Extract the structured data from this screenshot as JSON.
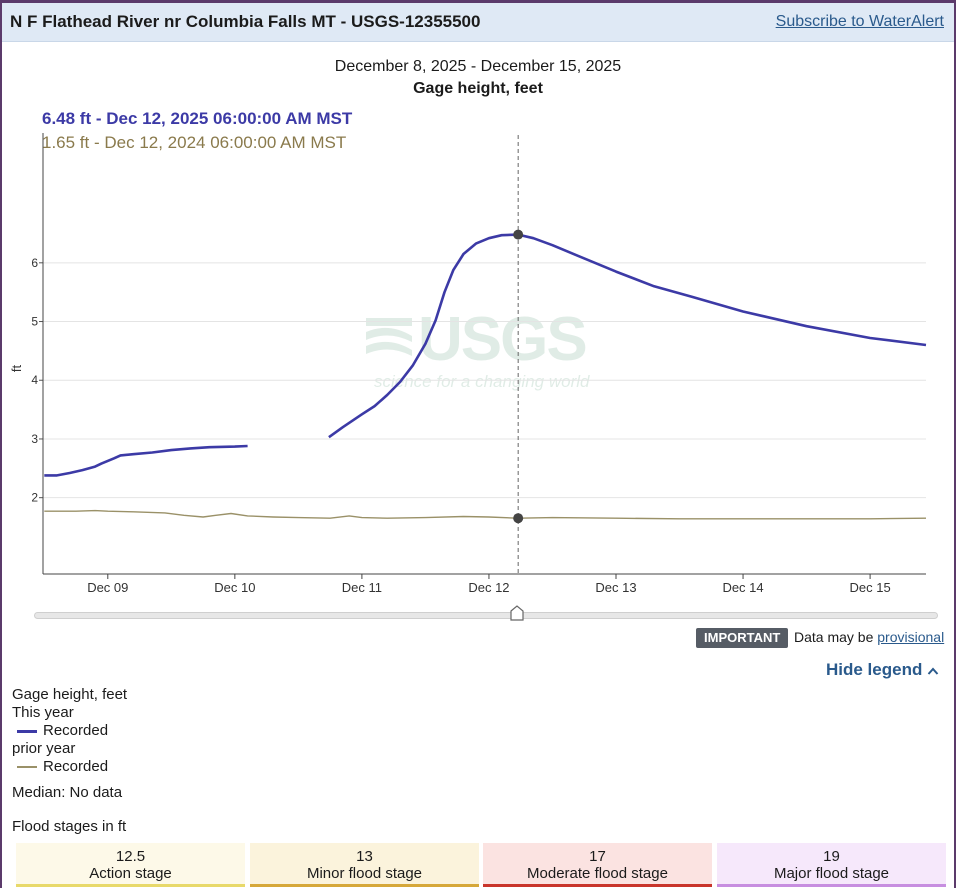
{
  "header": {
    "site_title": "N F Flathead River nr Columbia Falls MT - USGS-12355500",
    "subscribe_label": "Subscribe to WaterAlert"
  },
  "chart_header": {
    "date_range": "December 8, 2025 - December 15, 2025",
    "title": "Gage height, feet"
  },
  "tooltip": {
    "current": "6.48 ft - Dec 12, 2025 06:00:00 AM MST",
    "prior": "1.65 ft - Dec 12, 2024 06:00:00 AM MST"
  },
  "watermark": {
    "brand": "USGS",
    "tagline": "science for a changing world"
  },
  "colors": {
    "current": "#3c3aa6",
    "prior": "#9a9168",
    "accent": "#2a5a8c"
  },
  "chart_data": {
    "type": "line",
    "xlabel": "",
    "ylabel": "ft",
    "x_unit": "days since Dec 08 00:00",
    "xlim": [
      0.49,
      7.44
    ],
    "ylim": [
      0.7,
      7.7
    ],
    "y_ticks": [
      2,
      3,
      4,
      5,
      6
    ],
    "x_ticks": [
      {
        "pos": 1.0,
        "label": "Dec 09"
      },
      {
        "pos": 2.0,
        "label": "Dec 10"
      },
      {
        "pos": 3.0,
        "label": "Dec 11"
      },
      {
        "pos": 4.0,
        "label": "Dec 12"
      },
      {
        "pos": 5.0,
        "label": "Dec 13"
      },
      {
        "pos": 6.0,
        "label": "Dec 14"
      },
      {
        "pos": 7.0,
        "label": "Dec 15"
      }
    ],
    "cursor_x": 4.23,
    "series": [
      {
        "name": "This year",
        "segments": [
          [
            [
              0.5,
              2.38
            ],
            [
              0.6,
              2.38
            ],
            [
              0.7,
              2.42
            ],
            [
              0.8,
              2.47
            ],
            [
              0.9,
              2.53
            ],
            [
              0.95,
              2.58
            ],
            [
              1.05,
              2.67
            ],
            [
              1.1,
              2.72
            ],
            [
              1.2,
              2.74
            ],
            [
              1.35,
              2.77
            ],
            [
              1.5,
              2.81
            ],
            [
              1.65,
              2.84
            ],
            [
              1.8,
              2.86
            ],
            [
              2.0,
              2.87
            ],
            [
              2.1,
              2.88
            ]
          ],
          [
            [
              2.74,
              3.03
            ],
            [
              2.85,
              3.2
            ],
            [
              3.0,
              3.42
            ],
            [
              3.1,
              3.56
            ],
            [
              3.2,
              3.75
            ],
            [
              3.3,
              3.97
            ],
            [
              3.4,
              4.25
            ],
            [
              3.5,
              4.62
            ],
            [
              3.58,
              5.02
            ],
            [
              3.65,
              5.5
            ],
            [
              3.72,
              5.88
            ],
            [
              3.8,
              6.15
            ],
            [
              3.9,
              6.33
            ],
            [
              4.0,
              6.42
            ],
            [
              4.1,
              6.47
            ],
            [
              4.23,
              6.48
            ],
            [
              4.35,
              6.42
            ],
            [
              4.5,
              6.3
            ],
            [
              4.7,
              6.12
            ],
            [
              5.0,
              5.85
            ],
            [
              5.3,
              5.6
            ],
            [
              5.6,
              5.42
            ],
            [
              6.0,
              5.17
            ],
            [
              6.5,
              4.92
            ],
            [
              7.0,
              4.72
            ],
            [
              7.44,
              4.6
            ]
          ]
        ]
      },
      {
        "name": "prior year",
        "segments": [
          [
            [
              0.5,
              1.77
            ],
            [
              0.75,
              1.77
            ],
            [
              0.9,
              1.78
            ],
            [
              1.0,
              1.77
            ],
            [
              1.2,
              1.76
            ],
            [
              1.45,
              1.74
            ],
            [
              1.6,
              1.7
            ],
            [
              1.75,
              1.67
            ],
            [
              1.85,
              1.7
            ],
            [
              1.97,
              1.73
            ],
            [
              2.1,
              1.69
            ],
            [
              2.3,
              1.67
            ],
            [
              2.5,
              1.66
            ],
            [
              2.75,
              1.65
            ],
            [
              2.9,
              1.69
            ],
            [
              3.0,
              1.66
            ],
            [
              3.2,
              1.65
            ],
            [
              3.5,
              1.66
            ],
            [
              3.8,
              1.68
            ],
            [
              4.0,
              1.67
            ],
            [
              4.23,
              1.65
            ],
            [
              4.5,
              1.66
            ],
            [
              5.0,
              1.65
            ],
            [
              5.5,
              1.64
            ],
            [
              6.0,
              1.64
            ],
            [
              6.5,
              1.64
            ],
            [
              7.0,
              1.64
            ],
            [
              7.44,
              1.65
            ]
          ]
        ]
      }
    ]
  },
  "provisional": {
    "badge": "IMPORTANT",
    "text": "Data may be",
    "link": "provisional"
  },
  "legend": {
    "toggle_label": "Hide legend",
    "heading": "Gage height, feet",
    "this_year": "This year",
    "this_year_item": "Recorded",
    "prior_year": "prior year",
    "prior_year_item": "Recorded",
    "median": "Median: No data"
  },
  "flood_stages": {
    "title": "Flood stages in ft",
    "items": [
      {
        "value": "12.5",
        "label": "Action stage",
        "bg": "#fdf9e8",
        "line": "#e8d96a"
      },
      {
        "value": "13",
        "label": "Minor flood stage",
        "bg": "#fbf3dc",
        "line": "#d6a83a"
      },
      {
        "value": "17",
        "label": "Moderate flood stage",
        "bg": "#fbe3e1",
        "line": "#c9352b"
      },
      {
        "value": "19",
        "label": "Major flood stage",
        "bg": "#f6e8fb",
        "line": "#c78ee0"
      }
    ]
  }
}
